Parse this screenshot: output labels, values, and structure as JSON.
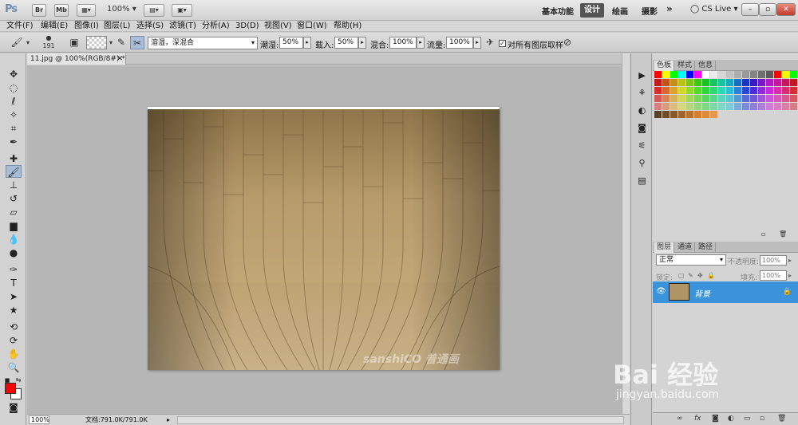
{
  "appbar": {
    "logo": "Ps",
    "br": "Br",
    "mb": "Mb",
    "zoom": "100%",
    "workspaces": [
      "基本功能",
      "设计",
      "绘画",
      "摄影",
      "»"
    ],
    "active_workspace": "设计",
    "cs_live": "CS Live"
  },
  "menubar": {
    "items": [
      "文件(F)",
      "编辑(E)",
      "图像(I)",
      "图层(L)",
      "选择(S)",
      "滤镜(T)",
      "分析(A)",
      "3D(D)",
      "视图(V)",
      "窗口(W)",
      "帮助(H)"
    ]
  },
  "options": {
    "brush_size": "191",
    "blend_mode": "溶湿，深混合",
    "wet_label": "潮湿:",
    "wet_value": "50%",
    "load_label": "载入:",
    "load_value": "50%",
    "mix_label": "混合:",
    "mix_value": "100%",
    "flow_label": "流量:",
    "flow_value": "100%",
    "sample_all_label": "对所有图层取样"
  },
  "document": {
    "tab_title": "11.jpg @ 100%(RGB/8#) *",
    "watermark": "sanshiCO 普通画"
  },
  "status": {
    "zoom": "100%",
    "doc_size": "文档:791.0K/791.0K"
  },
  "swatches_panel": {
    "tabs": [
      "色板",
      "样式",
      "信息"
    ]
  },
  "layers_panel": {
    "tabs": [
      "图层",
      "通道",
      "路径"
    ],
    "blend_mode": "正常",
    "opacity_label": "不透明度:",
    "opacity_value": "100%",
    "lock_label": "锁定:",
    "fill_label": "填充:",
    "fill_value": "100%",
    "layer_name": "背景"
  },
  "watermark_brand": {
    "line1": "Bai 经验",
    "line2": "jingyan.baidu.com"
  },
  "colors": {
    "foreground": "#ff0000",
    "background": "#ffffff",
    "layer_selected": "#3b93dc"
  }
}
